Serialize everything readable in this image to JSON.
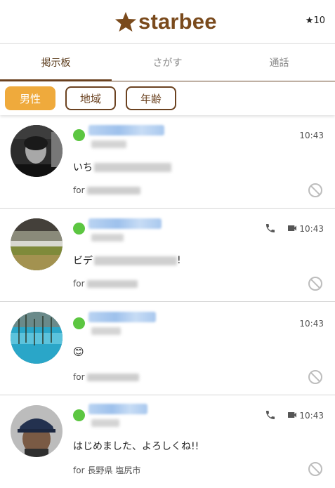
{
  "app": {
    "logo_text": "starbee",
    "points": "★10"
  },
  "tabs": [
    {
      "label": "掲示板",
      "active": true
    },
    {
      "label": "さがす",
      "active": false
    },
    {
      "label": "通話",
      "active": false
    }
  ],
  "filters": [
    {
      "label": "男性",
      "active": true
    },
    {
      "label": "地域",
      "active": false
    },
    {
      "label": "年齢",
      "active": false
    }
  ],
  "posts": [
    {
      "time": "10:43",
      "message_prefix": "いち",
      "for_prefix": "for",
      "for_text": "",
      "online": true,
      "call_icons": false
    },
    {
      "time": "10:43",
      "message_prefix": "ビデ",
      "message_suffix": "!",
      "for_prefix": "for",
      "for_text": "",
      "online": true,
      "call_icons": true
    },
    {
      "time": "10:43",
      "message_prefix": "😊",
      "for_prefix": "for",
      "for_text": "",
      "online": true,
      "call_icons": false
    },
    {
      "time": "10:43",
      "message_prefix": "はじめました、よろしくね!!",
      "for_prefix": "for",
      "for_text": "長野県 塩尻市",
      "online": true,
      "call_icons": true
    }
  ],
  "colors": {
    "brand_brown": "#6b4220",
    "accent_orange": "#efaa3c",
    "online_green": "#5cc641"
  }
}
